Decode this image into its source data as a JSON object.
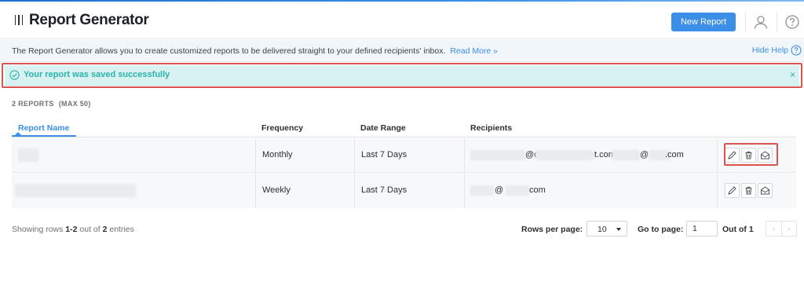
{
  "header": {
    "title": "Report Generator",
    "new_report_label": "New Report"
  },
  "help": {
    "text": "The Report Generator allows you to create customized reports to be delivered straight to your defined recipients' inbox.",
    "read_more": "Read More »",
    "hide_help": "Hide Help"
  },
  "alert": {
    "message": "Your report was saved successfully",
    "close": "×"
  },
  "reports_count": {
    "label": "2 REPORTS",
    "max": "(MAX 50)"
  },
  "table": {
    "columns": [
      "Report Name",
      "Frequency",
      "Date Range",
      "Recipients"
    ],
    "rows": [
      {
        "frequency": "Monthly",
        "date_range": "Last 7 Days",
        "recipients_parts": [
          "@d",
          "t.com,",
          "@",
          ".com"
        ]
      },
      {
        "frequency": "Weekly",
        "date_range": "Last 7 Days",
        "recipients_parts": [
          "@",
          "com"
        ]
      }
    ]
  },
  "footer": {
    "showing_prefix": "Showing rows",
    "showing_range": "1-2",
    "showing_mid": "out of",
    "showing_total": "2",
    "showing_suffix": "entries",
    "rows_per_page_label": "Rows per page:",
    "rows_per_page_value": "10",
    "go_to_page_label": "Go to page:",
    "go_to_page_value": "1",
    "out_of_label": "Out of 1",
    "prev_symbol": "‹",
    "next_symbol": "›"
  },
  "colors": {
    "accent": "#3b8fe6",
    "success": "#2bb3ad",
    "highlight_border": "#d9534f"
  },
  "icons": [
    "menu-icon",
    "user-icon",
    "help-circle-icon",
    "check-circle-icon",
    "close-icon",
    "edit-icon",
    "trash-icon",
    "email-icon",
    "chevron-down-icon",
    "chevron-left-icon",
    "chevron-right-icon"
  ]
}
